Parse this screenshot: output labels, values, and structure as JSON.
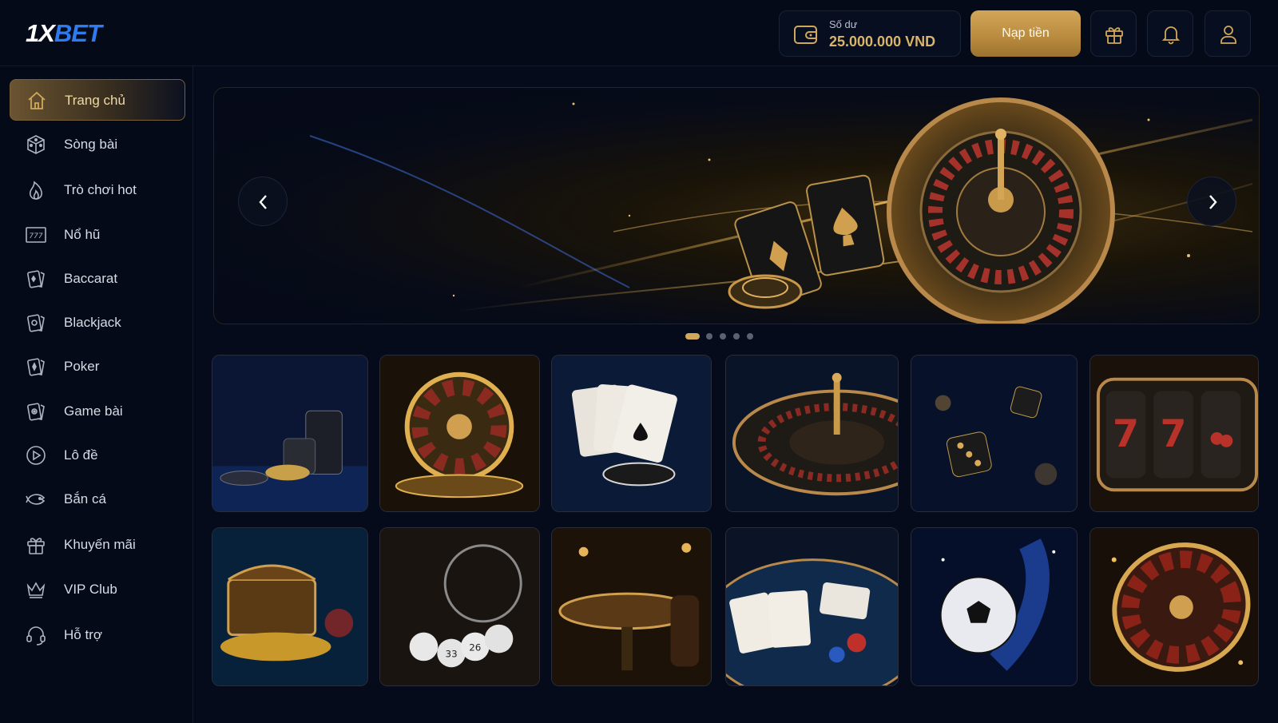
{
  "header": {
    "logo_part1": "1X",
    "logo_part2": "BET",
    "balance_label": "Số dư",
    "balance_value": "25.000.000 VND",
    "deposit_label": "Nạp tiền",
    "icons": [
      "wallet-icon",
      "gift-icon",
      "bell-icon",
      "user-icon"
    ]
  },
  "sidebar": {
    "items": [
      {
        "label": "Trang chủ",
        "icon": "home-icon",
        "active": true
      },
      {
        "label": "Sòng bài",
        "icon": "dice-icon"
      },
      {
        "label": "Trò chơi hot",
        "icon": "flame-icon"
      },
      {
        "label": "Nổ hũ",
        "icon": "slot-777-icon"
      },
      {
        "label": "Baccarat",
        "icon": "cards-icon"
      },
      {
        "label": "Blackjack",
        "icon": "cards-icon"
      },
      {
        "label": "Poker",
        "icon": "cards-icon"
      },
      {
        "label": "Game bài",
        "icon": "cards-icon"
      },
      {
        "label": "Lô đề",
        "icon": "play-circle-icon"
      },
      {
        "label": "Bắn cá",
        "icon": "fish-icon"
      },
      {
        "label": "Khuyến mãi",
        "icon": "gift-icon"
      },
      {
        "label": "VIP Club",
        "icon": "crown-icon"
      },
      {
        "label": "Hỗ trợ",
        "icon": "headset-icon"
      }
    ]
  },
  "banner": {
    "slide_count": 5,
    "active_slide": 1
  },
  "colors": {
    "background": "#050b1a",
    "accent_gold": "#d0a85a",
    "brand_blue": "#2e7bf0"
  }
}
